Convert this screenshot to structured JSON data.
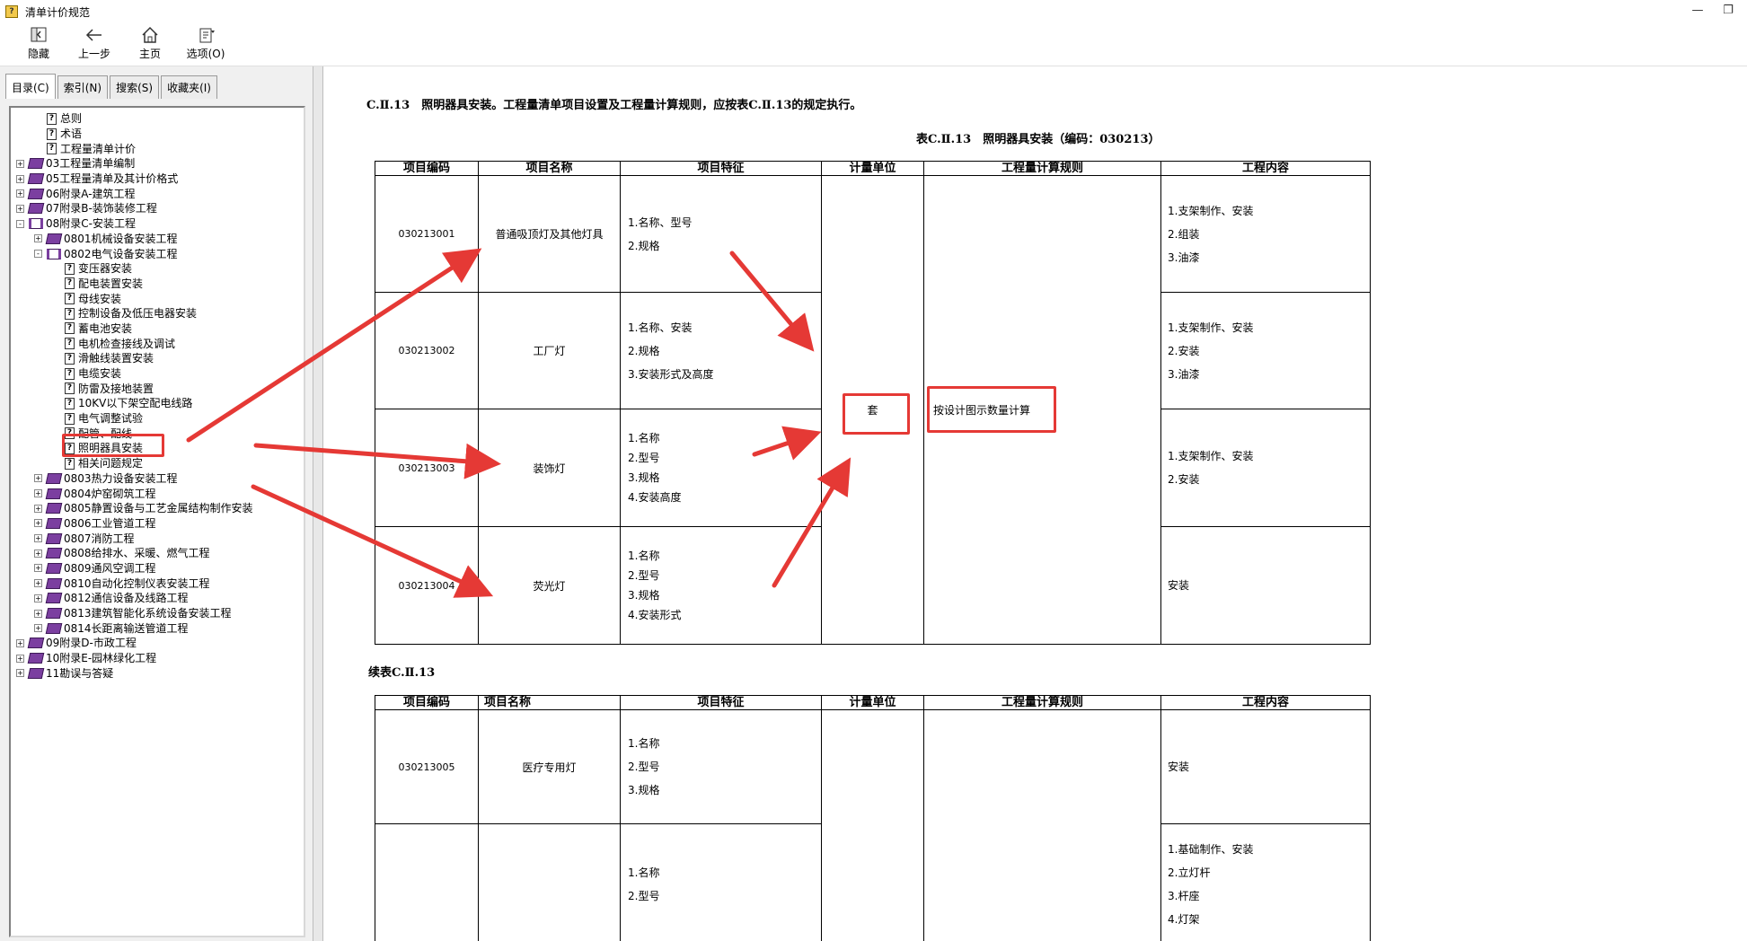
{
  "window": {
    "title": "清单计价规范",
    "app_icon": "help-book-icon"
  },
  "toolbar": {
    "hide_label": "隐藏",
    "back_label": "上一步",
    "home_label": "主页",
    "options_label": "选项(O)"
  },
  "tabs": {
    "contents": "目录(C)",
    "index": "索引(N)",
    "search": "搜索(S)",
    "favorites": "收藏夹(I)"
  },
  "tree": [
    {
      "label": "总则",
      "level": 1,
      "type": "page",
      "expander": ""
    },
    {
      "label": "术语",
      "level": 1,
      "type": "page",
      "expander": ""
    },
    {
      "label": "工程量清单计价",
      "level": 1,
      "type": "page",
      "expander": ""
    },
    {
      "label": "03工程量清单编制",
      "level": 0,
      "type": "book",
      "expander": "+"
    },
    {
      "label": "05工程量清单及其计价格式",
      "level": 0,
      "type": "book",
      "expander": "+"
    },
    {
      "label": "06附录A-建筑工程",
      "level": 0,
      "type": "book",
      "expander": "+"
    },
    {
      "label": "07附录B-装饰装修工程",
      "level": 0,
      "type": "book",
      "expander": "+"
    },
    {
      "label": "08附录C-安装工程",
      "level": 0,
      "type": "open-book",
      "expander": "−"
    },
    {
      "label": "0801机械设备安装工程",
      "level": 1,
      "type": "book",
      "expander": "+"
    },
    {
      "label": "0802电气设备安装工程",
      "level": 1,
      "type": "open-book",
      "expander": "−"
    },
    {
      "label": "变压器安装",
      "level": 2,
      "type": "page",
      "expander": ""
    },
    {
      "label": "配电装置安装",
      "level": 2,
      "type": "page",
      "expander": ""
    },
    {
      "label": "母线安装",
      "level": 2,
      "type": "page",
      "expander": ""
    },
    {
      "label": "控制设备及低压电器安装",
      "level": 2,
      "type": "page",
      "expander": ""
    },
    {
      "label": "蓄电池安装",
      "level": 2,
      "type": "page",
      "expander": ""
    },
    {
      "label": "电机检查接线及调试",
      "level": 2,
      "type": "page",
      "expander": ""
    },
    {
      "label": "滑触线装置安装",
      "level": 2,
      "type": "page",
      "expander": ""
    },
    {
      "label": "电缆安装",
      "level": 2,
      "type": "page",
      "expander": ""
    },
    {
      "label": "防雷及接地装置",
      "level": 2,
      "type": "page",
      "expander": ""
    },
    {
      "label": "10KV以下架空配电线路",
      "level": 2,
      "type": "page",
      "expander": ""
    },
    {
      "label": "电气调整试验",
      "level": 2,
      "type": "page",
      "expander": ""
    },
    {
      "label": "配管、配线",
      "level": 2,
      "type": "page",
      "expander": ""
    },
    {
      "label": "照明器具安装",
      "level": 2,
      "type": "page",
      "expander": "",
      "selected": true
    },
    {
      "label": "相关问题规定",
      "level": 2,
      "type": "page",
      "expander": ""
    },
    {
      "label": "0803热力设备安装工程",
      "level": 1,
      "type": "book",
      "expander": "+"
    },
    {
      "label": "0804炉窑砌筑工程",
      "level": 1,
      "type": "book",
      "expander": "+"
    },
    {
      "label": "0805静置设备与工艺金属结构制作安装",
      "level": 1,
      "type": "book",
      "expander": "+"
    },
    {
      "label": "0806工业管道工程",
      "level": 1,
      "type": "book",
      "expander": "+"
    },
    {
      "label": "0807消防工程",
      "level": 1,
      "type": "book",
      "expander": "+"
    },
    {
      "label": "0808给排水、采暖、燃气工程",
      "level": 1,
      "type": "book",
      "expander": "+"
    },
    {
      "label": "0809通风空调工程",
      "level": 1,
      "type": "book",
      "expander": "+"
    },
    {
      "label": "0810自动化控制仪表安装工程",
      "level": 1,
      "type": "book",
      "expander": "+"
    },
    {
      "label": "0812通信设备及线路工程",
      "level": 1,
      "type": "book",
      "expander": "+"
    },
    {
      "label": "0813建筑智能化系统设备安装工程",
      "level": 1,
      "type": "book",
      "expander": "+"
    },
    {
      "label": "0814长距离输送管道工程",
      "level": 1,
      "type": "book",
      "expander": "+"
    },
    {
      "label": "09附录D-市政工程",
      "level": 0,
      "type": "book",
      "expander": "+"
    },
    {
      "label": "10附录E-园林绿化工程",
      "level": 0,
      "type": "book",
      "expander": "+"
    },
    {
      "label": "11勘误与答疑",
      "level": 0,
      "type": "book",
      "expander": "+"
    }
  ],
  "doc": {
    "heading": "C.Ⅱ.13　照明器具安装。工程量清单项目设置及工程量计算规则，应按表C.Ⅱ.13的规定执行。",
    "table_caption": "表C.Ⅱ.13　照明器具安装（编码：030213）",
    "continued_caption": "续表C.Ⅱ.13",
    "columns": [
      "项目编码",
      "项目名称",
      "项目特征",
      "计量单位",
      "工程量计算规则",
      "工程内容"
    ],
    "unit": "套",
    "rule": "按设计图示数量计算",
    "rows": [
      {
        "code": "030213001",
        "name": "普通吸顶灯及其他灯具",
        "features": [
          "1.名称、型号",
          "2.规格"
        ],
        "work": [
          "1.支架制作、安装",
          "2.组装",
          "3.油漆"
        ]
      },
      {
        "code": "030213002",
        "name": "工厂灯",
        "features": [
          "1.名称、安装",
          "2.规格",
          "3.安装形式及高度"
        ],
        "work": [
          "1.支架制作、安装",
          "2.安装",
          "3.油漆"
        ]
      },
      {
        "code": "030213003",
        "name": "装饰灯",
        "features": [
          "1.名称",
          "2.型号",
          "3.规格",
          "4.安装高度"
        ],
        "work": [
          "1.支架制作、安装",
          "2.安装"
        ]
      },
      {
        "code": "030213004",
        "name": "荧光灯",
        "features": [
          "1.名称",
          "2.型号",
          "3.规格",
          "4.安装形式"
        ],
        "work": [
          "安装"
        ]
      }
    ],
    "rows2": [
      {
        "code": "030213005",
        "name": "医疗专用灯",
        "features": [
          "1.名称",
          "2.型号",
          "3.规格"
        ],
        "work": [
          "安装"
        ]
      },
      {
        "code": "",
        "name": "",
        "features": [
          "1.名称",
          "2.型号"
        ],
        "work": [
          "1.基础制作、安装",
          "2.立灯杆",
          "3.杆座",
          "4.灯架"
        ]
      }
    ]
  },
  "annotation_color": "#e53935"
}
